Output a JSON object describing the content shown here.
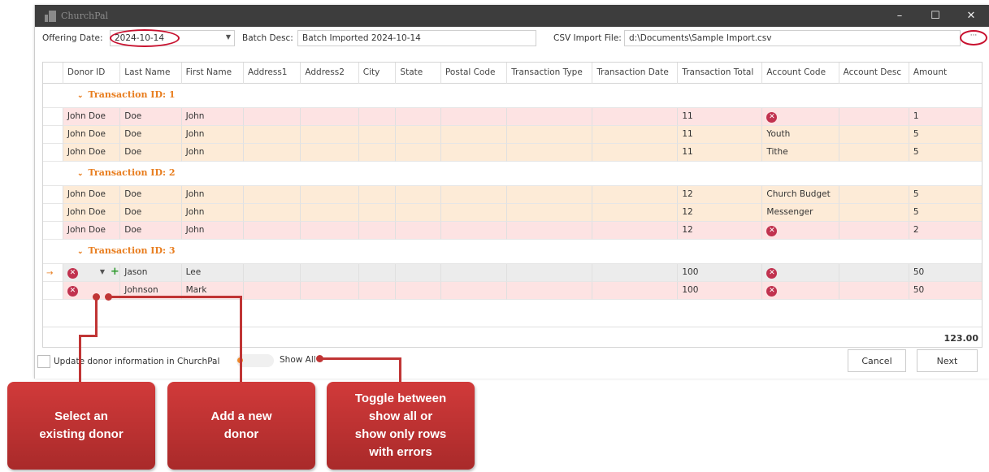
{
  "window": {
    "title": "ChurchPal",
    "minimize": "–",
    "maximize": "☐",
    "close": "✕"
  },
  "toolbar": {
    "offering_date_label": "Offering Date:",
    "offering_date_value": "2024-10-14",
    "batch_desc_label": "Batch Desc:",
    "batch_desc_value": "Batch Imported 2024-10-14",
    "csv_label": "CSV Import File:",
    "csv_value": "d:\\Documents\\Sample Import.csv",
    "browse": "···"
  },
  "grid": {
    "columns": [
      "Donor ID",
      "Last Name",
      "First Name",
      "Address1",
      "Address2",
      "City",
      "State",
      "Postal Code",
      "Transaction Type",
      "Transaction Date",
      "Transaction Total",
      "Account Code",
      "Account Desc",
      "Amount"
    ],
    "groups": [
      {
        "label": "Transaction ID: 1",
        "rows": [
          {
            "donor": "John Doe",
            "last": "Doe",
            "first": "John",
            "total": "11",
            "account": "",
            "account_error": true,
            "amount": "1",
            "style": "pink"
          },
          {
            "donor": "John Doe",
            "last": "Doe",
            "first": "John",
            "total": "11",
            "account": "Youth",
            "account_error": false,
            "amount": "5",
            "style": "peach"
          },
          {
            "donor": "John Doe",
            "last": "Doe",
            "first": "John",
            "total": "11",
            "account": "Tithe",
            "account_error": false,
            "amount": "5",
            "style": "peach"
          }
        ]
      },
      {
        "label": "Transaction ID: 2",
        "rows": [
          {
            "donor": "John Doe",
            "last": "Doe",
            "first": "John",
            "total": "12",
            "account": "Church Budget",
            "account_error": false,
            "amount": "5",
            "style": "peach"
          },
          {
            "donor": "John Doe",
            "last": "Doe",
            "first": "John",
            "total": "12",
            "account": "Messenger",
            "account_error": false,
            "amount": "5",
            "style": "peach"
          },
          {
            "donor": "John Doe",
            "last": "Doe",
            "first": "John",
            "total": "12",
            "account": "",
            "account_error": true,
            "amount": "2",
            "style": "pink"
          }
        ]
      },
      {
        "label": "Transaction ID: 3",
        "rows": [
          {
            "donor": "",
            "donor_error": true,
            "last": "Jason",
            "first": "Lee",
            "total": "100",
            "account": "",
            "account_error": true,
            "amount": "50",
            "style": "grey",
            "current": true
          },
          {
            "donor": "",
            "donor_error": true,
            "last": "Johnson",
            "first": "Mark",
            "total": "100",
            "account": "",
            "account_error": true,
            "amount": "50",
            "style": "pink"
          }
        ]
      }
    ],
    "grand_total": "123.00"
  },
  "footer": {
    "update_label": "Update donor information in ChurchPal",
    "toggle_label": "Show All",
    "cancel": "Cancel",
    "next": "Next"
  },
  "callouts": {
    "select_donor": [
      "Select an",
      "existing donor"
    ],
    "add_donor": [
      "Add a new",
      "donor"
    ],
    "toggle": [
      "Toggle between",
      "show all or",
      "show only rows",
      "with errors"
    ]
  },
  "colors": {
    "title_bar": "#3d3d3d",
    "accent_orange": "#e87d1e",
    "error": "#c1324f",
    "row_error": "#fde3e3",
    "row_ok": "#fdebd7",
    "callout": "#c03535"
  }
}
